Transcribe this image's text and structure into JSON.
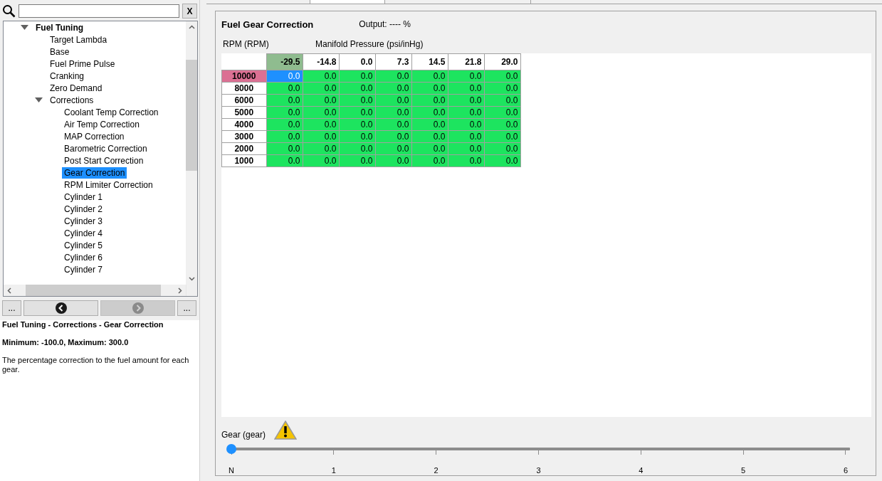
{
  "search": {
    "clear_button": "X"
  },
  "tree": [
    {
      "label": "Fuel Tuning",
      "expanded": true,
      "selected": false,
      "children": [
        {
          "label": "Target Lambda",
          "selected": false
        },
        {
          "label": "Base",
          "selected": false
        },
        {
          "label": "Fuel Prime Pulse",
          "selected": false
        },
        {
          "label": "Cranking",
          "selected": false
        },
        {
          "label": "Zero Demand",
          "selected": false
        },
        {
          "label": "Corrections",
          "expanded": true,
          "selected": false,
          "children": [
            {
              "label": "Coolant Temp Correction",
              "selected": false
            },
            {
              "label": "Air Temp Correction",
              "selected": false
            },
            {
              "label": "MAP Correction",
              "selected": false
            },
            {
              "label": "Barometric Correction",
              "selected": false
            },
            {
              "label": "Post Start Correction",
              "selected": false
            },
            {
              "label": "Gear Correction",
              "selected": true
            },
            {
              "label": "RPM Limiter Correction",
              "selected": false
            },
            {
              "label": "Cylinder 1",
              "selected": false
            },
            {
              "label": "Cylinder 2",
              "selected": false
            },
            {
              "label": "Cylinder 3",
              "selected": false
            },
            {
              "label": "Cylinder 4",
              "selected": false
            },
            {
              "label": "Cylinder 5",
              "selected": false
            },
            {
              "label": "Cylinder 6",
              "selected": false
            },
            {
              "label": "Cylinder 7",
              "selected": false
            }
          ]
        }
      ]
    }
  ],
  "nav": [
    {
      "kind": "more",
      "label": "...",
      "disabled": false
    },
    {
      "kind": "back",
      "disabled": false
    },
    {
      "kind": "forward",
      "disabled": true
    },
    {
      "kind": "more",
      "label": "...",
      "disabled": false
    }
  ],
  "help": {
    "path": "Fuel Tuning - Corrections - Gear Correction",
    "range": "Minimum: -100.0, Maximum: 300.0",
    "description": "The percentage correction to the fuel amount for each gear."
  },
  "table": {
    "title": "Fuel Gear Correction",
    "output": "Output: ---- %",
    "row_axis": "RPM (RPM)",
    "column_axis": "Manifold Pressure (psi/inHg)",
    "columns": [
      {
        "label": "-29.5",
        "selected": true
      },
      {
        "label": "-14.8",
        "selected": false
      },
      {
        "label": "0.0",
        "selected": false
      },
      {
        "label": "7.3",
        "selected": false
      },
      {
        "label": "14.5",
        "selected": false
      },
      {
        "label": "21.8",
        "selected": false
      },
      {
        "label": "29.0",
        "selected": false
      }
    ],
    "rows": [
      {
        "label": "10000",
        "selected": true,
        "cells": [
          {
            "value": "0.0",
            "selected": true
          },
          {
            "value": "0.0",
            "selected": false
          },
          {
            "value": "0.0",
            "selected": false
          },
          {
            "value": "0.0",
            "selected": false
          },
          {
            "value": "0.0",
            "selected": false
          },
          {
            "value": "0.0",
            "selected": false
          },
          {
            "value": "0.0",
            "selected": false
          }
        ]
      },
      {
        "label": "8000",
        "selected": false,
        "cells": [
          {
            "value": "0.0",
            "selected": false
          },
          {
            "value": "0.0",
            "selected": false
          },
          {
            "value": "0.0",
            "selected": false
          },
          {
            "value": "0.0",
            "selected": false
          },
          {
            "value": "0.0",
            "selected": false
          },
          {
            "value": "0.0",
            "selected": false
          },
          {
            "value": "0.0",
            "selected": false
          }
        ]
      },
      {
        "label": "6000",
        "selected": false,
        "cells": [
          {
            "value": "0.0",
            "selected": false
          },
          {
            "value": "0.0",
            "selected": false
          },
          {
            "value": "0.0",
            "selected": false
          },
          {
            "value": "0.0",
            "selected": false
          },
          {
            "value": "0.0",
            "selected": false
          },
          {
            "value": "0.0",
            "selected": false
          },
          {
            "value": "0.0",
            "selected": false
          }
        ]
      },
      {
        "label": "5000",
        "selected": false,
        "cells": [
          {
            "value": "0.0",
            "selected": false
          },
          {
            "value": "0.0",
            "selected": false
          },
          {
            "value": "0.0",
            "selected": false
          },
          {
            "value": "0.0",
            "selected": false
          },
          {
            "value": "0.0",
            "selected": false
          },
          {
            "value": "0.0",
            "selected": false
          },
          {
            "value": "0.0",
            "selected": false
          }
        ]
      },
      {
        "label": "4000",
        "selected": false,
        "cells": [
          {
            "value": "0.0",
            "selected": false
          },
          {
            "value": "0.0",
            "selected": false
          },
          {
            "value": "0.0",
            "selected": false
          },
          {
            "value": "0.0",
            "selected": false
          },
          {
            "value": "0.0",
            "selected": false
          },
          {
            "value": "0.0",
            "selected": false
          },
          {
            "value": "0.0",
            "selected": false
          }
        ]
      },
      {
        "label": "3000",
        "selected": false,
        "cells": [
          {
            "value": "0.0",
            "selected": false
          },
          {
            "value": "0.0",
            "selected": false
          },
          {
            "value": "0.0",
            "selected": false
          },
          {
            "value": "0.0",
            "selected": false
          },
          {
            "value": "0.0",
            "selected": false
          },
          {
            "value": "0.0",
            "selected": false
          },
          {
            "value": "0.0",
            "selected": false
          }
        ]
      },
      {
        "label": "2000",
        "selected": false,
        "cells": [
          {
            "value": "0.0",
            "selected": false
          },
          {
            "value": "0.0",
            "selected": false
          },
          {
            "value": "0.0",
            "selected": false
          },
          {
            "value": "0.0",
            "selected": false
          },
          {
            "value": "0.0",
            "selected": false
          },
          {
            "value": "0.0",
            "selected": false
          },
          {
            "value": "0.0",
            "selected": false
          }
        ]
      },
      {
        "label": "1000",
        "selected": false,
        "cells": [
          {
            "value": "0.0",
            "selected": false
          },
          {
            "value": "0.0",
            "selected": false
          },
          {
            "value": "0.0",
            "selected": false
          },
          {
            "value": "0.0",
            "selected": false
          },
          {
            "value": "0.0",
            "selected": false
          },
          {
            "value": "0.0",
            "selected": false
          },
          {
            "value": "0.0",
            "selected": false
          }
        ]
      }
    ]
  },
  "gear_slider": {
    "label": "Gear (gear)",
    "warning": true,
    "level": 0,
    "ticks": [
      "N",
      "1",
      "2",
      "3",
      "4",
      "5",
      "6"
    ]
  }
}
